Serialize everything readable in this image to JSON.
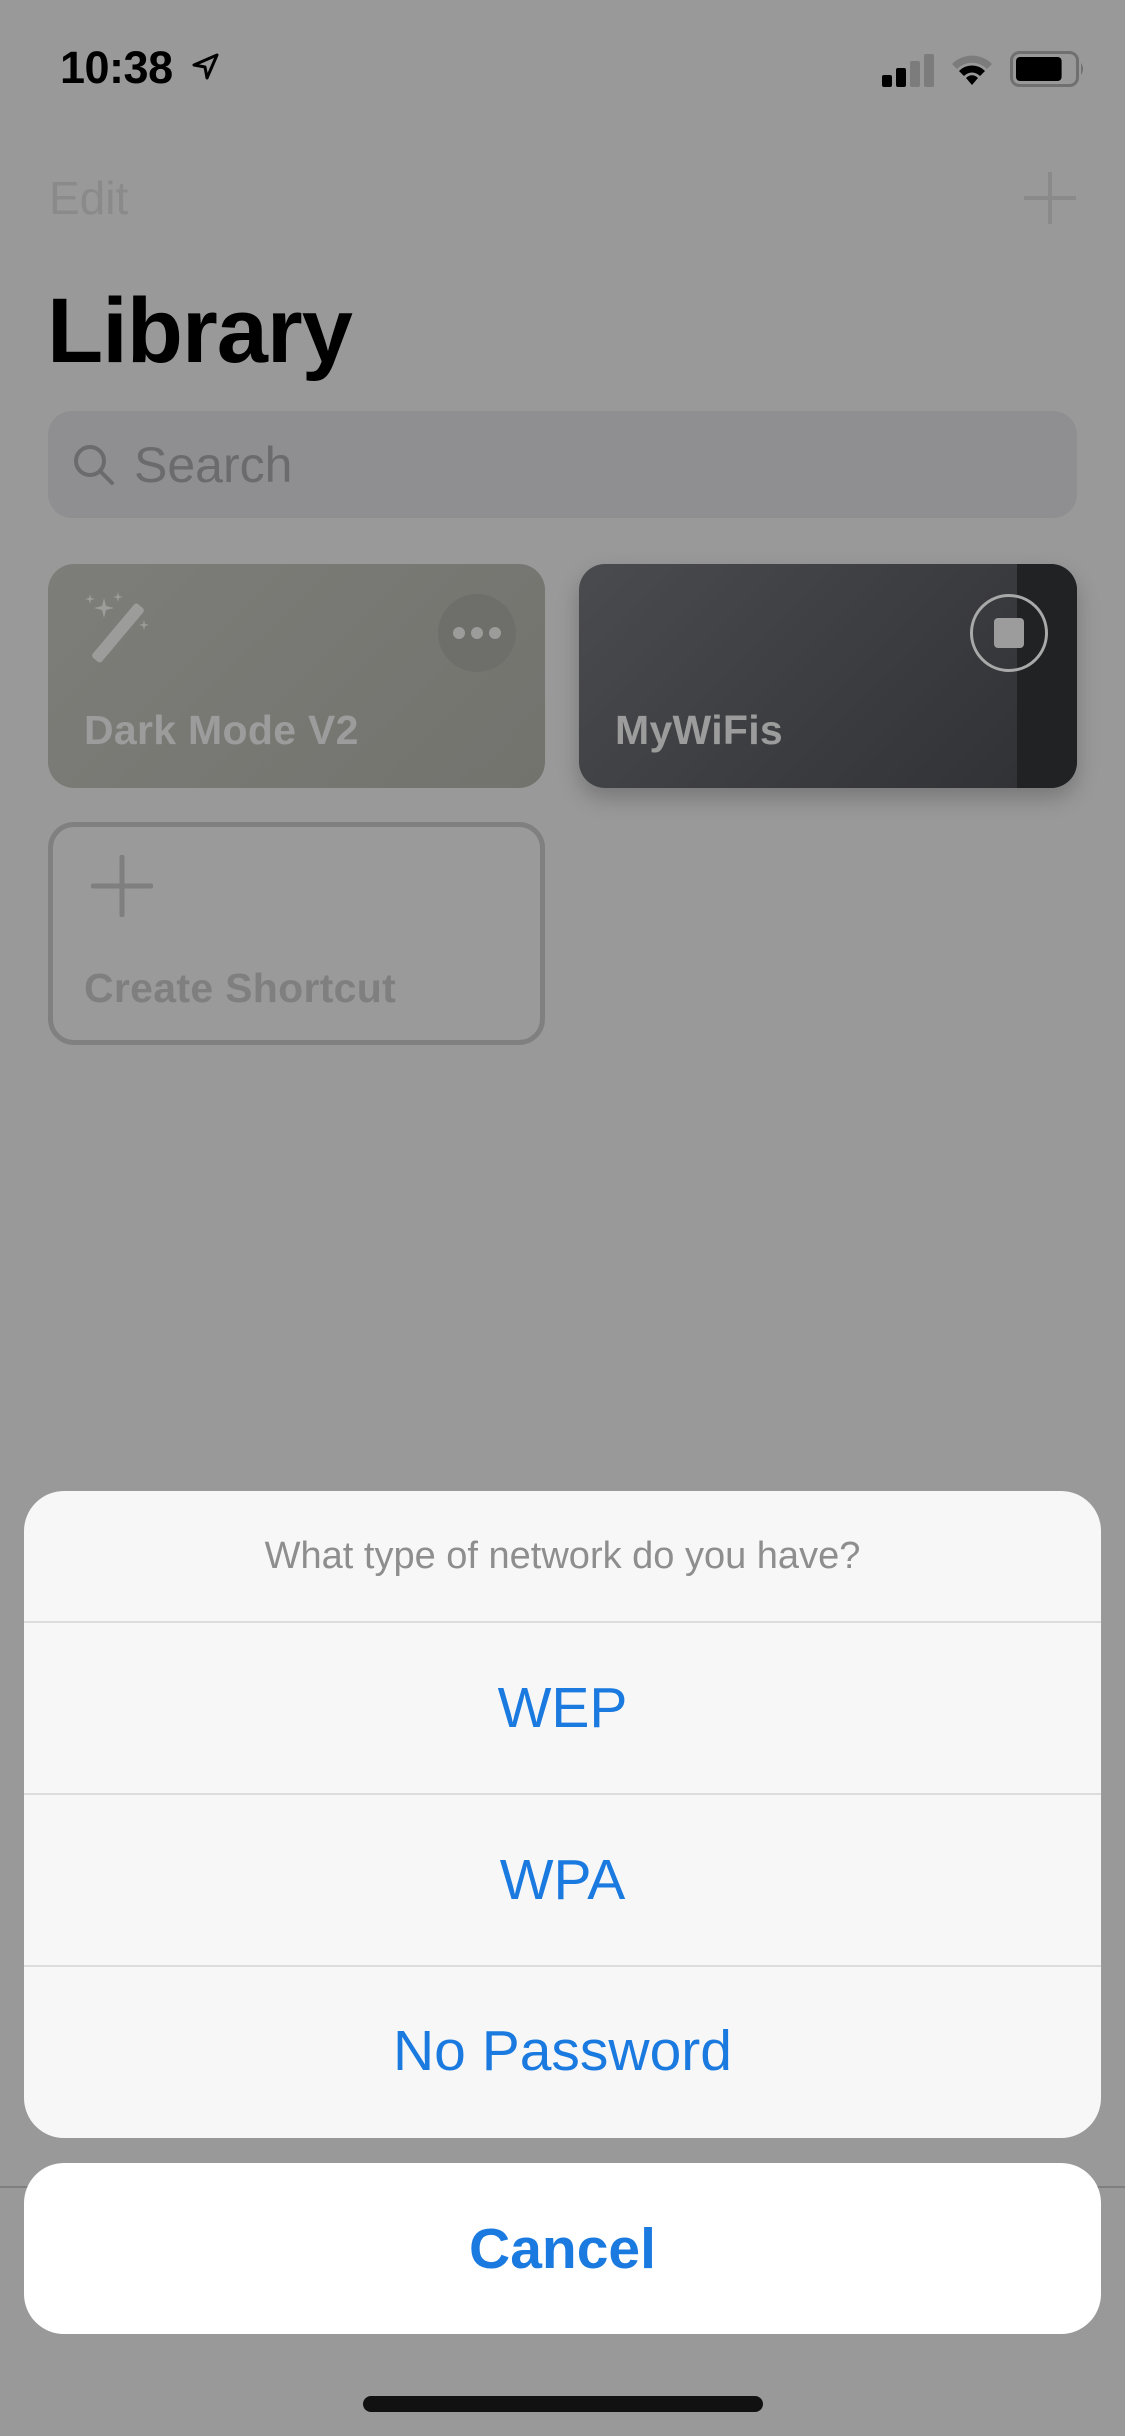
{
  "status_bar": {
    "time": "10:38",
    "location_icon": "location-arrow-icon",
    "signal_bars": 2,
    "signal_bars_total": 4,
    "wifi_strength": 2,
    "wifi_strength_total": 3,
    "battery_level_percent": 80
  },
  "nav": {
    "edit_label": "Edit",
    "add_icon": "plus-icon"
  },
  "page": {
    "title": "Library"
  },
  "search": {
    "placeholder": "Search",
    "value": "",
    "icon": "magnifying-glass-icon"
  },
  "shortcuts": [
    {
      "title": "Dark Mode V2",
      "icon": "magic-wand-icon",
      "action_icon": "more-ellipsis-icon",
      "color": "#7a7a76"
    },
    {
      "title": "MyWiFis",
      "icon": "stop-icon",
      "running": true,
      "progress": 0.88,
      "color": "#3c3d41"
    }
  ],
  "create_shortcut": {
    "label": "Create Shortcut",
    "icon": "plus-icon"
  },
  "action_sheet": {
    "message": "What type of network do you have?",
    "options": [
      {
        "label": "WEP"
      },
      {
        "label": "WPA"
      },
      {
        "label": "No Password"
      }
    ],
    "cancel_label": "Cancel",
    "accent_color": "#1a7ae0"
  }
}
